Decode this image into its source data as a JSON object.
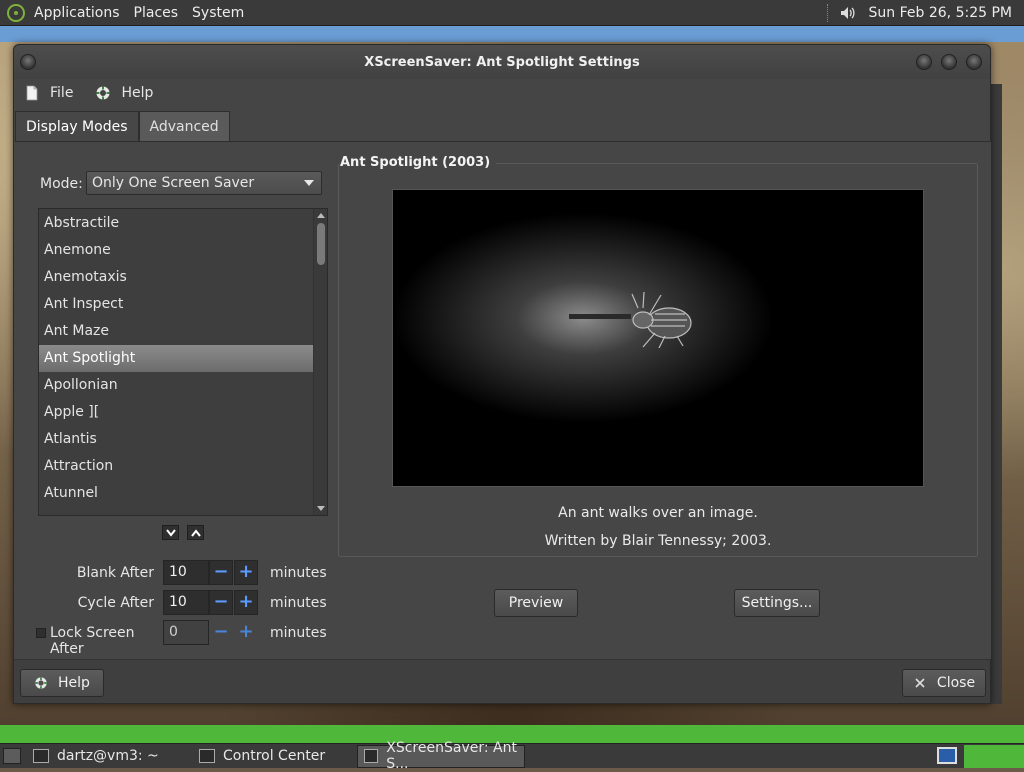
{
  "top_panel": {
    "menus": [
      "Applications",
      "Places",
      "System"
    ],
    "clock": "Sun Feb 26,  5:25 PM"
  },
  "window": {
    "title": "XScreenSaver: Ant Spotlight Settings",
    "menubar": {
      "file": "File",
      "help": "Help"
    },
    "tabs": [
      {
        "label": "Display Modes",
        "active": true
      },
      {
        "label": "Advanced",
        "active": false
      }
    ],
    "mode": {
      "label": "Mode:",
      "value": "Only One Screen Saver"
    },
    "savers": [
      "Abstractile",
      "Anemone",
      "Anemotaxis",
      "Ant Inspect",
      "Ant Maze",
      "Ant Spotlight",
      "Apollonian",
      "Apple ][",
      "Atlantis",
      "Attraction",
      "Atunnel"
    ],
    "selected_saver": "Ant Spotlight",
    "settings": {
      "blank_after": {
        "label": "Blank After",
        "value": "10",
        "unit": "minutes"
      },
      "cycle_after": {
        "label": "Cycle After",
        "value": "10",
        "unit": "minutes"
      },
      "lock_after": {
        "label": "Lock Screen After",
        "value": "0",
        "unit": "minutes",
        "checked": false
      }
    },
    "preview_frame": {
      "title": "Ant Spotlight (2003)",
      "description": "An ant walks over an image.",
      "author": "Written by Blair Tennessy; 2003."
    },
    "buttons": {
      "preview": "Preview",
      "settings": "Settings...",
      "help": "Help",
      "close": "Close"
    }
  },
  "taskbar": {
    "tasks": [
      {
        "label": "dartz@vm3: ~",
        "active": false
      },
      {
        "label": "Control Center",
        "active": false
      },
      {
        "label": "XScreenSaver: Ant S...",
        "active": true
      }
    ]
  },
  "colors": {
    "panel_bg": "#3a3a3a",
    "window_bg": "#464646",
    "accent_blue": "#5b9bff",
    "selection": "#7a7a7a"
  }
}
